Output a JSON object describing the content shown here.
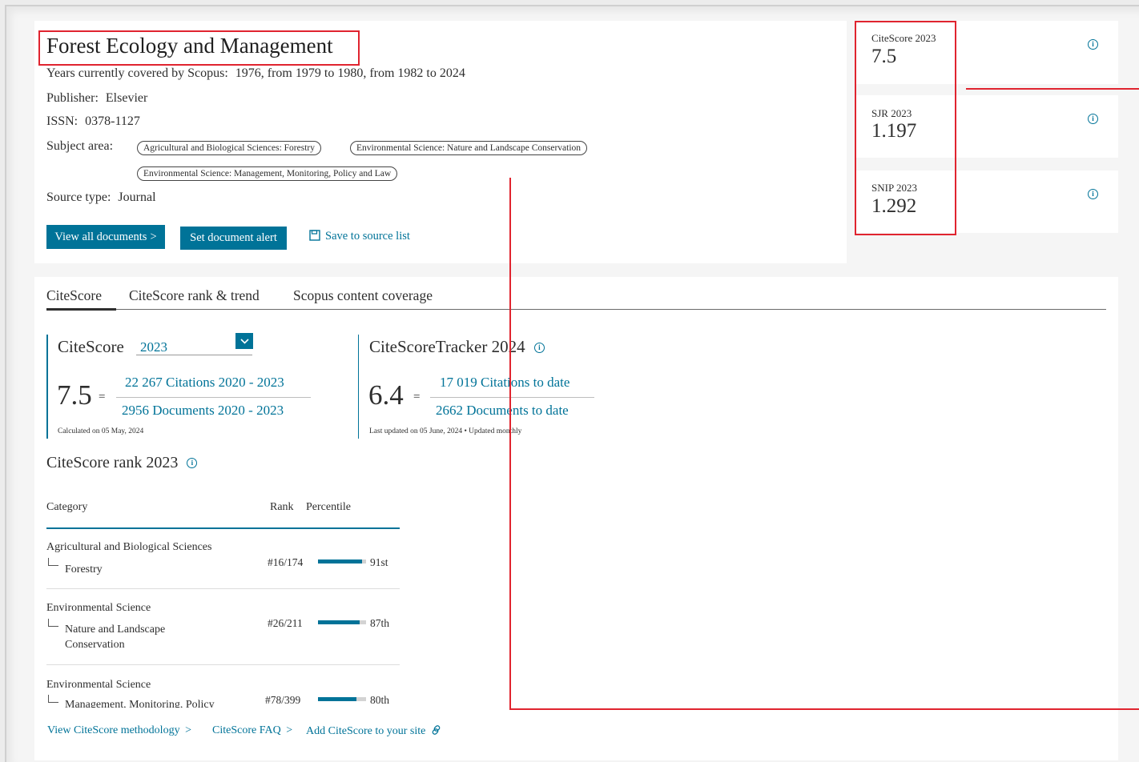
{
  "source": {
    "title": "Forest Ecology and Management",
    "years_label": "Years currently covered by Scopus:",
    "years_value": "1976, from 1979 to 1980, from 1982 to 2024",
    "publisher_label": "Publisher:",
    "publisher_value": "Elsevier",
    "issn_label": "ISSN:",
    "issn_value": "0378-1127",
    "subject_label": "Subject area:",
    "subjects": [
      "Agricultural and Biological Sciences: Forestry",
      "Environmental Science: Nature and Landscape Conservation",
      "Environmental Science: Management, Monitoring, Policy and Law"
    ],
    "source_type_label": "Source type:",
    "source_type_value": "Journal"
  },
  "actions": {
    "view_all": "View all documents",
    "view_all_chevron": ">",
    "set_alert": "Set document alert",
    "save_to_list": "Save to source list"
  },
  "metrics": [
    {
      "label": "CiteScore 2023",
      "value": "7.5"
    },
    {
      "label": "SJR 2023",
      "value": "1.197"
    },
    {
      "label": "SNIP 2023",
      "value": "1.292"
    }
  ],
  "info_glyph": "i",
  "tabs": [
    "CiteScore",
    "CiteScore rank & trend",
    "Scopus content coverage"
  ],
  "citescore": {
    "heading": "CiteScore",
    "year_select": "2023",
    "value": "7.5",
    "equals": "=",
    "citations": "22 267 Citations 2020 - 2023",
    "documents": "2956 Documents 2020 - 2023",
    "calculated": "Calculated on 05 May, 2024"
  },
  "tracker": {
    "heading": "CiteScoreTracker 2024",
    "value": "6.4",
    "equals": "=",
    "citations": "17 019 Citations to date",
    "documents": "2662 Documents to date",
    "updated": "Last updated on 05 June, 2024 • Updated monthly"
  },
  "rank": {
    "heading": "CiteScore rank 2023",
    "col_category": "Category",
    "col_rank": "Rank",
    "col_percentile": "Percentile",
    "rows": [
      {
        "category": "Agricultural and Biological Sciences",
        "sub1": "Forestry",
        "sub2": "",
        "rank": "#16/174",
        "percentile_label": "91st",
        "percentile": 91
      },
      {
        "category": "Environmental Science",
        "sub1": "Nature and Landscape",
        "sub2": "Conservation",
        "rank": "#26/211",
        "percentile_label": "87th",
        "percentile": 87
      },
      {
        "category": "Environmental Science",
        "sub1": "Management, Monitoring, Policy",
        "sub2": "",
        "rank": "#78/399",
        "percentile_label": "80th",
        "percentile": 80
      }
    ]
  },
  "footer_links": {
    "methodology": "View CiteScore methodology",
    "faq": "CiteScore FAQ",
    "add_site": "Add CiteScore to your site",
    "chevron": ">"
  },
  "colors": {
    "accent": "#007398",
    "annotation_red": "#e0242f",
    "bar_track": "#d3d3d3"
  }
}
